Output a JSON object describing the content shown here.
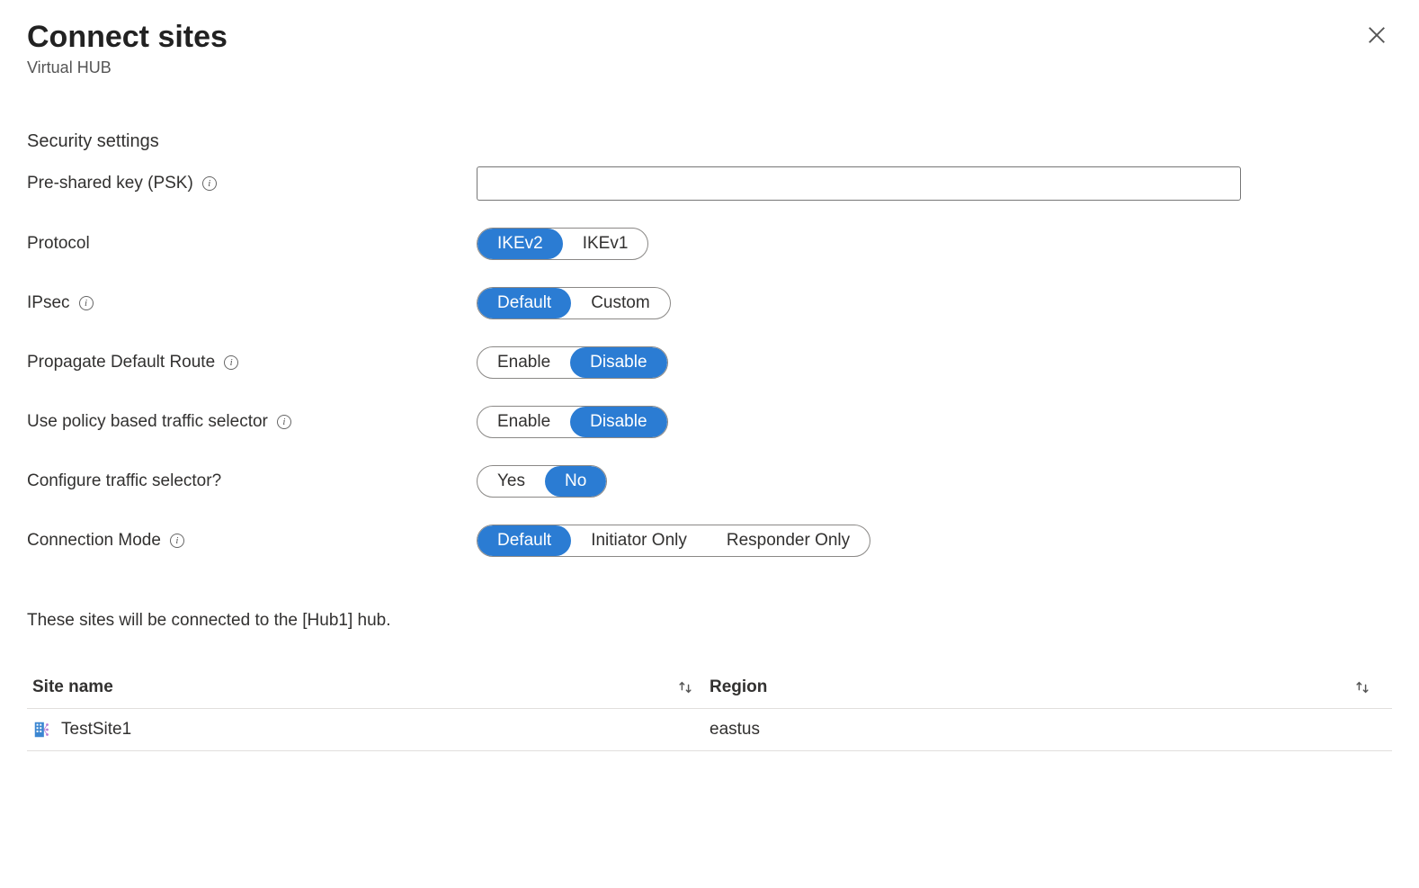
{
  "header": {
    "title": "Connect sites",
    "subtitle": "Virtual HUB"
  },
  "section_heading": "Security settings",
  "form": {
    "psk": {
      "label": "Pre-shared key (PSK)",
      "value": ""
    },
    "protocol": {
      "label": "Protocol",
      "options": [
        "IKEv2",
        "IKEv1"
      ],
      "selected": "IKEv2"
    },
    "ipsec": {
      "label": "IPsec",
      "options": [
        "Default",
        "Custom"
      ],
      "selected": "Default"
    },
    "propagate": {
      "label": "Propagate Default Route",
      "options": [
        "Enable",
        "Disable"
      ],
      "selected": "Disable"
    },
    "policy_selector": {
      "label": "Use policy based traffic selector",
      "options": [
        "Enable",
        "Disable"
      ],
      "selected": "Disable"
    },
    "configure_selector": {
      "label": "Configure traffic selector?",
      "options": [
        "Yes",
        "No"
      ],
      "selected": "No"
    },
    "connection_mode": {
      "label": "Connection Mode",
      "options": [
        "Default",
        "Initiator Only",
        "Responder Only"
      ],
      "selected": "Default"
    }
  },
  "hint": "These sites will be connected to the [Hub1] hub.",
  "table": {
    "columns": {
      "site": "Site name",
      "region": "Region"
    },
    "rows": [
      {
        "site": "TestSite1",
        "region": "eastus"
      }
    ]
  }
}
